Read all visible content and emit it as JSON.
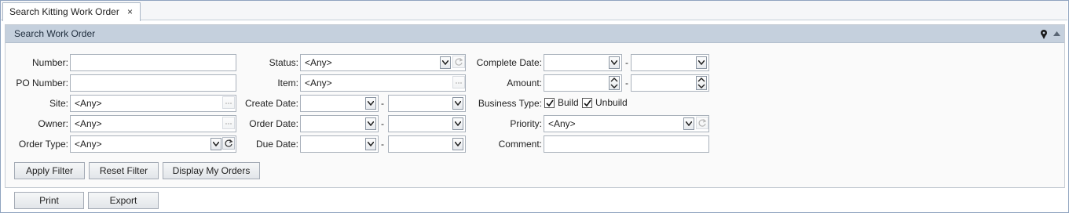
{
  "tabs": [
    {
      "label": "Search Kitting Work Order",
      "close": "×"
    }
  ],
  "panel": {
    "title": "Search Work Order"
  },
  "fields": {
    "number": {
      "label": "Number:",
      "value": ""
    },
    "po_number": {
      "label": "PO Number:",
      "value": ""
    },
    "site": {
      "label": "Site:",
      "value": "<Any>"
    },
    "owner": {
      "label": "Owner:",
      "value": "<Any>"
    },
    "order_type": {
      "label": "Order Type:",
      "value": "<Any>"
    },
    "status": {
      "label": "Status:",
      "value": "<Any>"
    },
    "item": {
      "label": "Item:",
      "value": "<Any>"
    },
    "create_date": {
      "label": "Create Date:",
      "from": "",
      "to": ""
    },
    "order_date": {
      "label": "Order Date:",
      "from": "",
      "to": ""
    },
    "due_date": {
      "label": "Due Date:",
      "from": "",
      "to": ""
    },
    "complete_date": {
      "label": "Complete Date:",
      "from": "",
      "to": ""
    },
    "amount": {
      "label": "Amount:",
      "from": "",
      "to": ""
    },
    "business_type": {
      "label": "Business Type:",
      "options": [
        {
          "label": "Build",
          "checked": true
        },
        {
          "label": "Unbuild",
          "checked": true
        }
      ]
    },
    "priority": {
      "label": "Priority:",
      "value": "<Any>"
    },
    "comment": {
      "label": "Comment:",
      "value": ""
    }
  },
  "range_separator": "-",
  "buttons": {
    "apply": "Apply Filter",
    "reset": "Reset Filter",
    "my_orders": "Display My Orders",
    "print": "Print",
    "export": "Export"
  }
}
